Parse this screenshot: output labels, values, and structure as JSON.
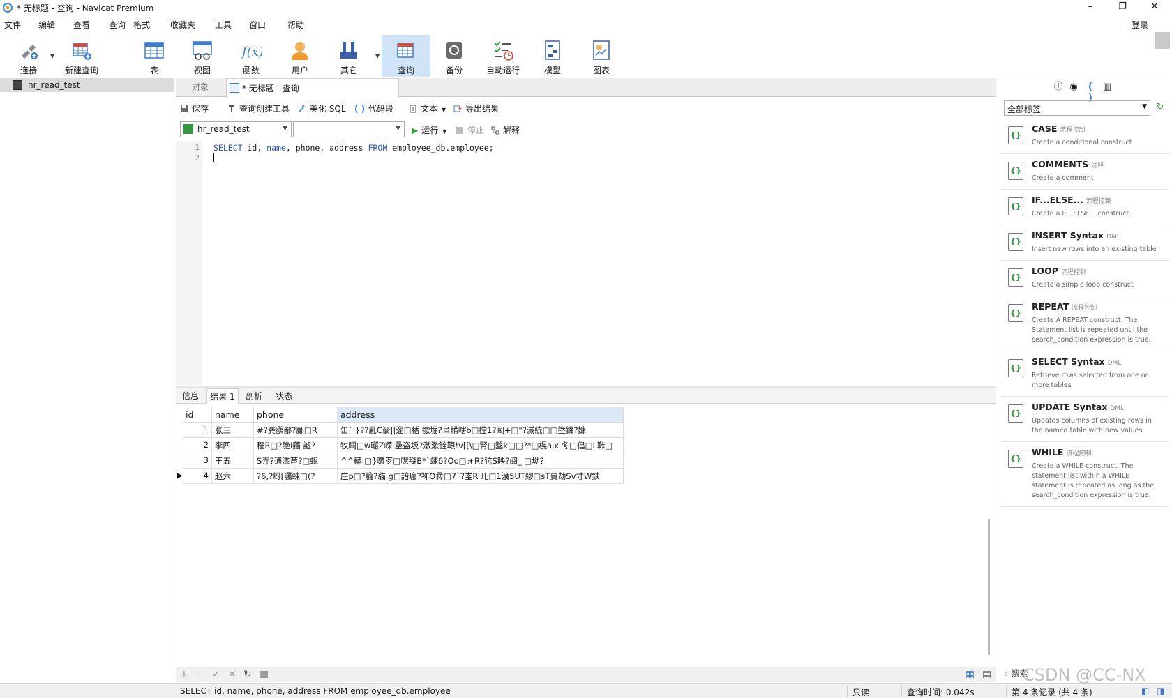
{
  "window": {
    "title": "* 无标题 - 查询 - Navicat Premium",
    "controls": [
      "–",
      "❐",
      "✕"
    ]
  },
  "menu": {
    "items": [
      "文件",
      "编辑",
      "查看",
      "查询",
      "格式",
      "收藏夹",
      "工具",
      "窗口",
      "帮助"
    ],
    "login": "登录"
  },
  "toolbar": {
    "buttons": [
      {
        "label": "连接",
        "icon": "connect-icon"
      },
      {
        "label": "新建查询",
        "icon": "new-query-icon"
      },
      {
        "label": "表",
        "icon": "table-icon"
      },
      {
        "label": "视图",
        "icon": "view-icon"
      },
      {
        "label": "函数",
        "icon": "function-icon"
      },
      {
        "label": "用户",
        "icon": "user-icon"
      },
      {
        "label": "其它",
        "icon": "tools-icon"
      },
      {
        "label": "查询",
        "icon": "query-icon"
      },
      {
        "label": "备份",
        "icon": "backup-icon"
      },
      {
        "label": "自动运行",
        "icon": "automation-icon"
      },
      {
        "label": "模型",
        "icon": "model-icon"
      },
      {
        "label": "图表",
        "icon": "chart-icon"
      }
    ],
    "active": "查询"
  },
  "nav": {
    "connection": "hr_read_test"
  },
  "tabs": {
    "objects": "对象",
    "query": "* 无标题 - 查询"
  },
  "query_toolbar": {
    "save": "保存",
    "builder": "查询创建工具",
    "beautify": "美化 SQL",
    "snippet": "代码段",
    "text": "文本",
    "export": "导出结果"
  },
  "selectors": {
    "connection": "hr_read_test",
    "database": "",
    "run": "运行",
    "stop": "停止",
    "explain": "解释"
  },
  "editor": {
    "line_numbers": [
      "1",
      "2"
    ],
    "sql": {
      "kw_select": "SELECT",
      "cols": " id, ",
      "kw_name": "name",
      "rest": ", phone, address ",
      "kw_from": "FROM",
      "table": " employee_db.employee;"
    }
  },
  "result_tabs": [
    "信息",
    "结果 1",
    "剖析",
    "状态"
  ],
  "grid": {
    "columns": [
      "id",
      "name",
      "phone",
      "address"
    ],
    "rows": [
      {
        "id": "1",
        "name": "张三",
        "phone": "#?龚鷂鄙?鄺□R",
        "address": "缶`  }??薍C嵡||淄□楿  撳堀?阜鞴嗐b□摚1?阃+□\"?滅統□□墍錣?嫝"
      },
      {
        "id": "2",
        "name": "李四",
        "phone": "穡R□?脃I蘠   譃?",
        "address": "牧眮□w曮Z嵘   曐盗坂?澂漱铨鞎!v[[\\□腎□鑿k□□?*□榥alx   冬□倡□L鞐□"
      },
      {
        "id": "3",
        "name": "王五",
        "phone": "S弄?逋潻茞?□蜺",
        "address": "^^輏I□}隳歹□嚖搿B*`竦6?Oo□ォR?犺S眏?阅_  □坳?"
      },
      {
        "id": "4",
        "name": "赵六",
        "phone": "?6,?岈[囑蛛□(?",
        "address": "庄p□?朧?貓   g□諳瘢?祢O彛□7`?崟R   玌□1瀇5UT繆□sT蕒劫Sv寸W鉄"
      }
    ],
    "current_row_marker": "▶"
  },
  "status": {
    "sql": "SELECT id, name, phone, address FROM employee_db.employee",
    "readonly": "只读",
    "query_time": "查询时间: 0.042s",
    "record": "第 4 条记录 (共 4 条)"
  },
  "snippets": {
    "tag_filter": "全部标签",
    "items": [
      {
        "name": "CASE",
        "tag": "流程控制",
        "desc": "Create a conditional construct"
      },
      {
        "name": "COMMENTS",
        "tag": "注释",
        "desc": "Create a comment"
      },
      {
        "name": "IF...ELSE...",
        "tag": "流程控制",
        "desc": "Create a IF...ELSE... construct"
      },
      {
        "name": "INSERT Syntax",
        "tag": "DML",
        "desc": "Insert new rows into an existing table"
      },
      {
        "name": "LOOP",
        "tag": "流程控制",
        "desc": "Create a simple loop construct"
      },
      {
        "name": "REPEAT",
        "tag": "流程控制",
        "desc": "Create A REPEAT construct. The Statement list is repeated until the search_condition expression is true."
      },
      {
        "name": "SELECT Syntax",
        "tag": "DML",
        "desc": "Retrieve rows selected from one or more tables"
      },
      {
        "name": "UPDATE Syntax",
        "tag": "DML",
        "desc": "Updates columns of existing rows in the named table with new values"
      },
      {
        "name": "WHILE",
        "tag": "流程控制",
        "desc": "Create a WHILE construct. The statement list within a WHILE statement is repeated as long as the search_condition expression is true."
      }
    ],
    "search": "搜索"
  },
  "watermark": "CSDN @CC-NX"
}
